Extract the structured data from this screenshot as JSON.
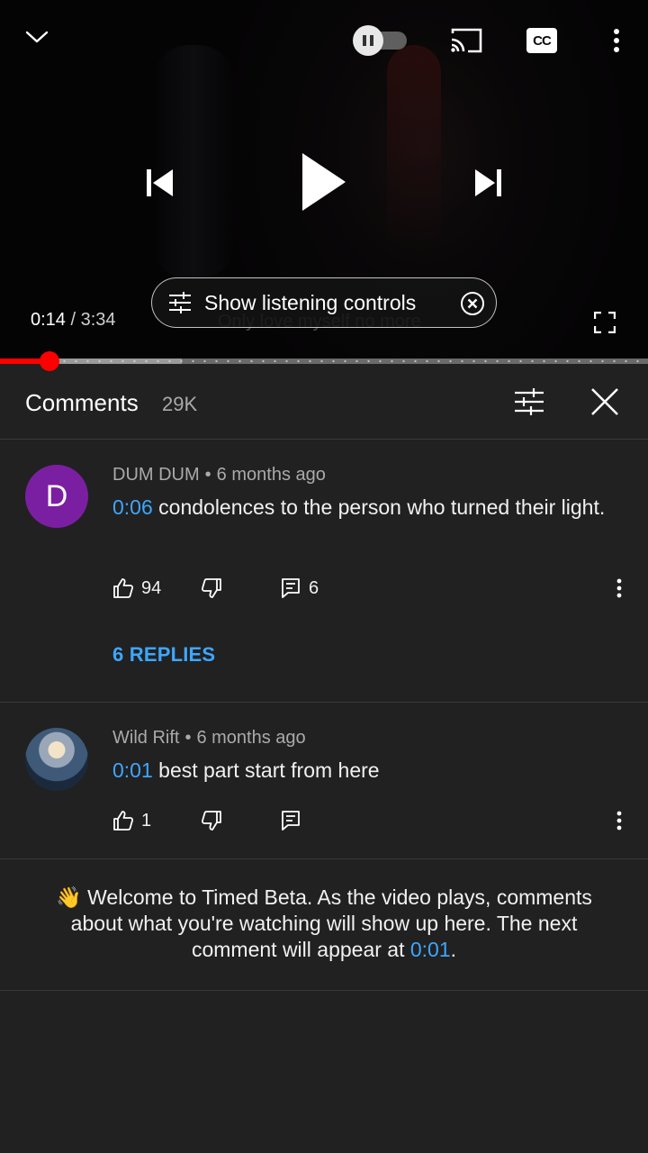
{
  "player": {
    "current_time": "0:14",
    "separator": "/",
    "duration": "3:34",
    "caption_text": "Only love myself no more",
    "listening_controls_label": "Show listening controls",
    "progress_played_fraction": 0.065,
    "progress_buffered_fraction": 0.28,
    "cc_label": "CC",
    "autoplay_on": false
  },
  "comments_panel": {
    "title": "Comments",
    "count": "29K",
    "comments": [
      {
        "avatar_letter": "D",
        "avatar_color": "#7b1fa2",
        "author": "DUM DUM",
        "age": "6 months ago",
        "timestamp": "0:06",
        "text": "condolences to the person who turned their light.",
        "likes": "94",
        "reply_count": "6",
        "replies_link": "6 REPLIES"
      },
      {
        "avatar_image": "anime-character-avatar",
        "author": "Wild Rift",
        "age": "6 months ago",
        "timestamp": "0:01",
        "text": "best part start from here",
        "likes": "1"
      }
    ],
    "beta_note": {
      "emoji": "👋",
      "text_before": "Welcome to Timed Beta. As the video plays, comments about what you're watching will show up here. The next comment will appear at ",
      "timestamp": "0:01",
      "text_after": "."
    }
  },
  "colors": {
    "accent_blue": "#3ea6ff",
    "progress_red": "#ff0000",
    "panel_bg": "#212121"
  },
  "icons": {
    "collapse": "chevron-down-icon",
    "cast": "cast-icon",
    "more": "more-vert-icon",
    "previous": "skip-previous-icon",
    "play": "play-icon",
    "next": "skip-next-icon",
    "fullscreen": "fullscreen-icon",
    "sliders": "tune-icon",
    "close": "close-icon",
    "like": "thumb-up-icon",
    "dislike": "thumb-down-icon",
    "reply": "comment-icon"
  }
}
